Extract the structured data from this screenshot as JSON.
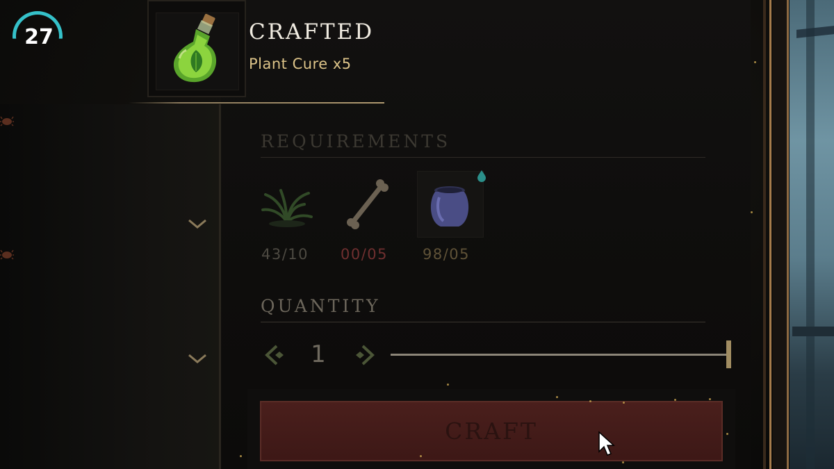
{
  "hud": {
    "fps_value": "27",
    "fps_color": "#35c1c9"
  },
  "crafted": {
    "title": "CRAFTED",
    "item": "Plant Cure x5",
    "item_icon": "green-potion-icon"
  },
  "requirements": {
    "label": "REQUIREMENTS",
    "items": [
      {
        "icon": "fiber-plant-icon",
        "count": "43/10",
        "status": "ok"
      },
      {
        "icon": "bone-icon",
        "count": "00/05",
        "status": "insufficient"
      },
      {
        "icon": "clay-jar-icon",
        "count": "98/05",
        "status": "ok"
      }
    ]
  },
  "quantity": {
    "label": "QUANTITY",
    "value": "1",
    "slider_fraction": 1.0
  },
  "craft_button": {
    "label": "CRAFT",
    "state": "disabled"
  },
  "colors": {
    "accent_gold": "#ddc489",
    "insufficient_red": "#6f2f2f",
    "craft_button_bg": "#4a1f1c"
  }
}
